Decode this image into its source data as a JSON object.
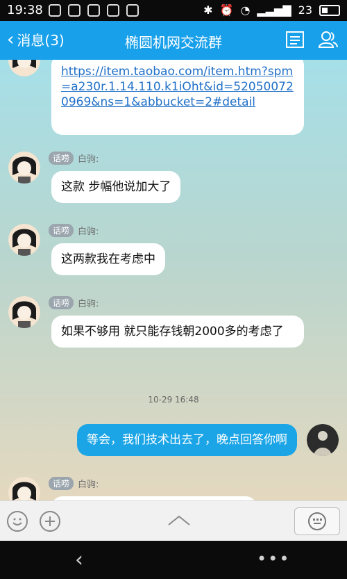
{
  "status_bar": {
    "time": "19:38",
    "battery_level": "23"
  },
  "header": {
    "back_label": "消息(3)",
    "title": "椭圆机网交流群"
  },
  "messages": [
    {
      "type": "link",
      "text": "https://item.taobao.com/item.htm?spm=a230r.1.14.110.k1iOht&id=520500720969&ns=1&abbucket=2#detail"
    },
    {
      "type": "incoming",
      "badge": "话唠",
      "name": "白驹:",
      "text": "这款 步幅他说加大了"
    },
    {
      "type": "incoming",
      "badge": "话唠",
      "name": "白驹:",
      "text": "这两款我在考虑中"
    },
    {
      "type": "incoming",
      "badge": "话唠",
      "name": "白驹:",
      "text": "如果不够用 就只能存钱朝2000多的考虑了"
    },
    {
      "type": "timestamp",
      "text": "10-29 16:48"
    },
    {
      "type": "outgoing",
      "text": "等会，我们技术出去了，晚点回答你啊"
    },
    {
      "type": "incoming",
      "badge": "话唠",
      "name": "白驹:",
      "text": ""
    }
  ],
  "colors": {
    "header": "#18a0ea",
    "outgoing_bubble": "#1ba5e6",
    "link": "#2070c8"
  }
}
